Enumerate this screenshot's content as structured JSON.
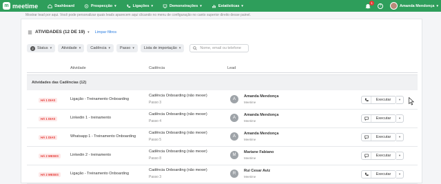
{
  "topbar": {
    "logo_mark": "m",
    "logo_text": "meetime",
    "nav": [
      {
        "label": "Dashboard",
        "icon": "home-icon"
      },
      {
        "label": "Prospecção",
        "icon": "target-icon"
      },
      {
        "label": "Ligações",
        "icon": "phone-icon"
      },
      {
        "label": "Demonstrações",
        "icon": "monitor-icon"
      },
      {
        "label": "Estatísticas",
        "icon": "chart-icon"
      }
    ],
    "notifications": "1",
    "help": "?",
    "user_name": "Amanda Mendonça"
  },
  "tip": "Mostrar lead por aqui. Você pode personalizar quais leads aparecem aqui clicando no menu de configuração no canto superior direito desse painel.",
  "header": {
    "title": "ATIVIDADES (12 DE 19)",
    "clear": "Limpar filtros"
  },
  "filters": {
    "status_count": "2",
    "items": [
      "Status",
      "Atividade",
      "Cadência",
      "Passo",
      "Lista de importação"
    ],
    "search_placeholder": "Nome, email ou telefone"
  },
  "table": {
    "columns": [
      "Atividade",
      "Cadência",
      "Lead"
    ],
    "group_label": "Atividades das Cadências (12)",
    "rows": [
      {
        "badge": "HÁ 1 DIAS",
        "activity": "Ligação - Treinamento Onboarding",
        "cadence": "Cadência Onboarding (não mexer)",
        "step": "Passo 3",
        "lead_initial": "A",
        "lead_name": "Amanda Mendonça",
        "lead_company": "Meetime",
        "exec_icon": "phone-icon",
        "exec_label": "Executar"
      },
      {
        "badge": "HÁ 1 DIAS",
        "activity": "Linkedin 1 - treinamento",
        "cadence": "Cadência Onboarding (não mexer)",
        "step": "Passo 4",
        "lead_initial": "A",
        "lead_name": "Amanda Mendonça",
        "lead_company": "Meetime",
        "exec_icon": "chat-icon",
        "exec_label": "Executar"
      },
      {
        "badge": "HÁ 1 DIAS",
        "activity": "Whatsapp 1 - Treinamento Onboarding",
        "cadence": "Cadência Onboarding (não mexer)",
        "step": "Passo 5",
        "lead_initial": "A",
        "lead_name": "Amanda Mendonça",
        "lead_company": "Meetime",
        "exec_icon": "chat-icon",
        "exec_label": "Executar"
      },
      {
        "badge": "HÁ 2 MESES",
        "activity": "Linkedin 2 - treinamento",
        "cadence": "Cadência Onboarding (não mexer)",
        "step": "Passo 8",
        "lead_initial": "M",
        "lead_name": "Mariane Fabiano",
        "lead_company": "Meetime",
        "exec_icon": "chat-icon",
        "exec_label": "Executar"
      },
      {
        "badge": "HÁ 2 MESES",
        "activity": "Ligação - Treinamento Onboarding",
        "cadence": "Cadência Onboarding (não mexer)",
        "step": "Passo 3",
        "lead_initial": "R",
        "lead_name": "Rui Cesar Aviz",
        "lead_company": "Meetime",
        "exec_icon": "phone-icon",
        "exec_label": "Executar"
      }
    ]
  }
}
